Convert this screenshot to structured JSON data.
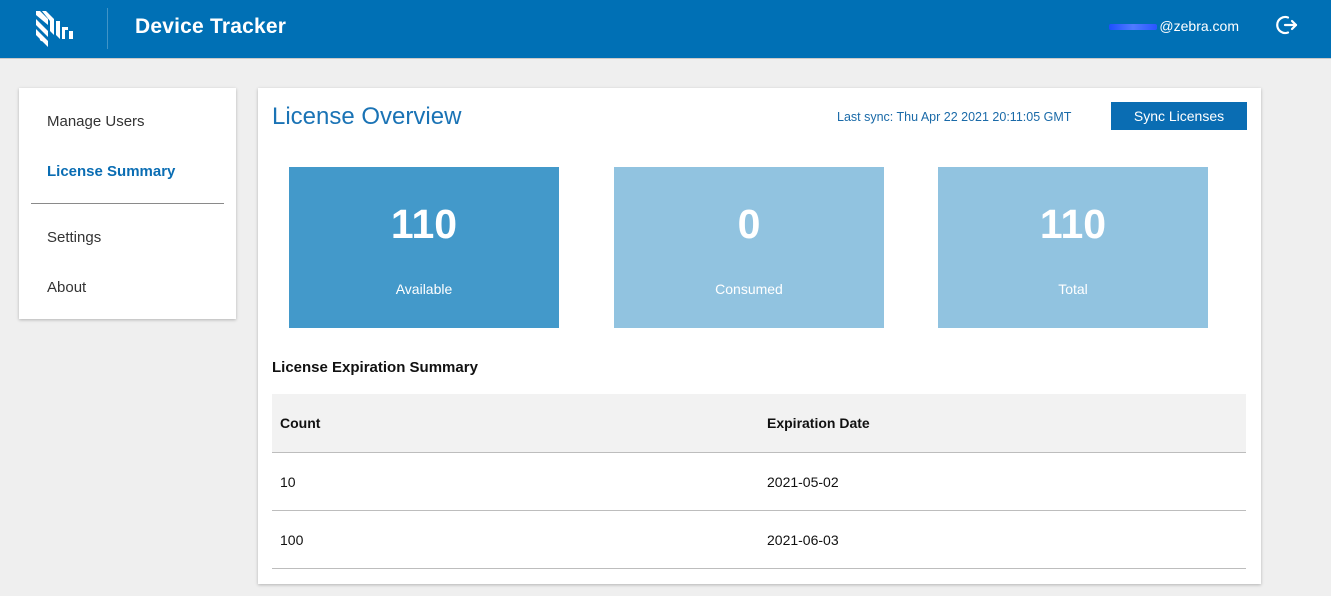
{
  "header": {
    "app_title": "Device Tracker",
    "user_email_visible": "@zebra.com",
    "logo_icon": "zebra-logo-icon",
    "logout_icon": "logout-icon"
  },
  "sidebar": {
    "items": [
      {
        "label": "Manage Users",
        "active": false
      },
      {
        "label": "License Summary",
        "active": true
      },
      {
        "label": "Settings",
        "active": false
      },
      {
        "label": "About",
        "active": false
      }
    ]
  },
  "main": {
    "title": "License Overview",
    "last_sync": "Last sync: Thu Apr 22 2021 20:11:05 GMT",
    "sync_button_label": "Sync Licenses",
    "cards": [
      {
        "value": "110",
        "label": "Available"
      },
      {
        "value": "0",
        "label": "Consumed"
      },
      {
        "value": "110",
        "label": "Total"
      }
    ],
    "expiration_title": "License Expiration Summary",
    "table": {
      "headers": [
        "Count",
        "Expiration Date"
      ],
      "rows": [
        [
          "10",
          "2021-05-02"
        ],
        [
          "100",
          "2021-06-03"
        ]
      ]
    }
  },
  "colors": {
    "header_bg": "#0070b5",
    "accent": "#0a6db3",
    "card_available": "#4399ca",
    "card_other": "#91c3e0"
  }
}
